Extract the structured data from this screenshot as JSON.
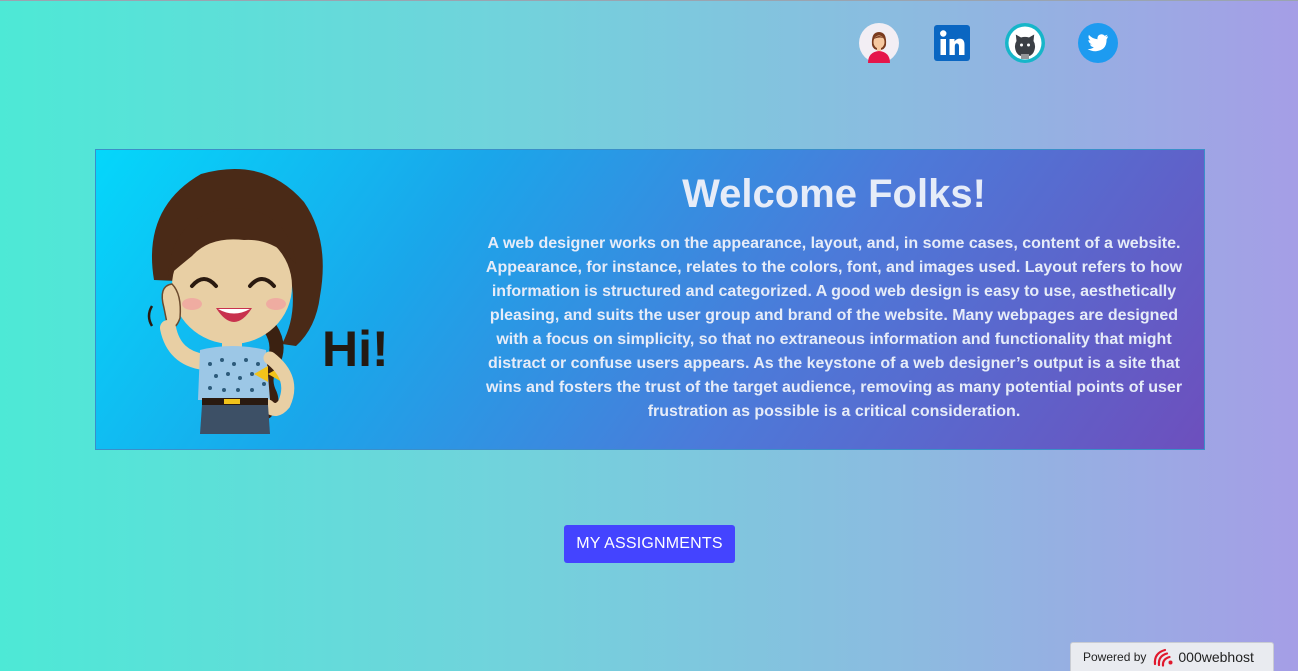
{
  "social": [
    {
      "name": "profile",
      "icon": "avatar-icon"
    },
    {
      "name": "linkedin",
      "icon": "linkedin-icon",
      "label": "in"
    },
    {
      "name": "github",
      "icon": "github-icon"
    },
    {
      "name": "twitter",
      "icon": "twitter-icon"
    }
  ],
  "card": {
    "illustration_text": "Hi!",
    "title": "Welcome Folks!",
    "body": "A web designer works on the appearance, layout, and, in some cases, content of a website. Appearance, for instance, relates to the colors, font, and images used. Layout refers to how information is structured and categorized. A good web design is easy to use, aesthetically pleasing, and suits the user group and brand of the website. Many webpages are designed with a focus on simplicity, so that no extraneous information and functionality that might distract or confuse users appears. As the keystone of a web designer’s output is a site that wins and fosters the trust of the target audience, removing as many potential points of user frustration as possible is a critical consideration."
  },
  "assignments_button": "MY ASSIGNMENTS",
  "footer": {
    "powered_by": "Powered by",
    "brand": "000webhost"
  },
  "colors": {
    "button": "#4444ff",
    "linkedin": "#0a66c2",
    "github_ring": "#16b6c9",
    "twitter": "#1d9bf0"
  }
}
